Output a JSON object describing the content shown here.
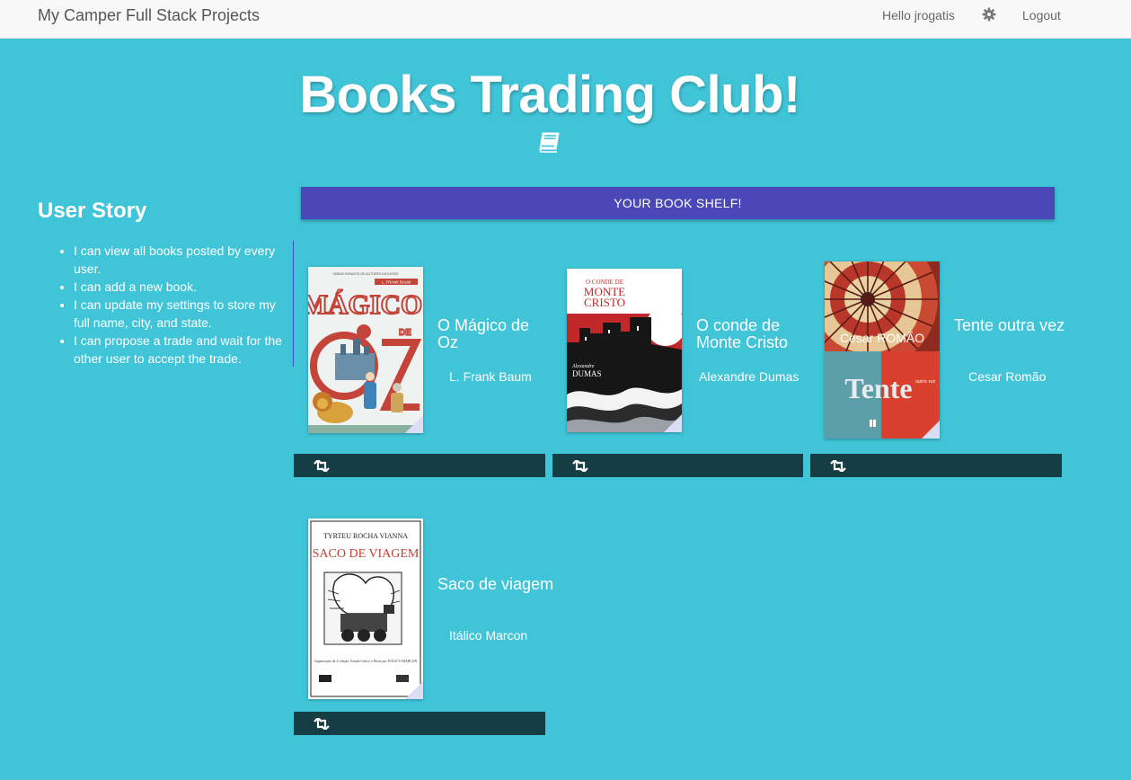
{
  "navbar": {
    "brand": "My Camper Full Stack Projects",
    "greeting": "Hello jrogatis",
    "settings_icon": "gear-icon",
    "logout_label": "Logout"
  },
  "hero": {
    "title": "Books Trading Club!",
    "icon": "book-icon"
  },
  "user_story": {
    "title": "User Story",
    "items": [
      "I can view all books posted by every user.",
      "I can add a new book.",
      "I can update my settings to store my full name, city, and state.",
      "I can propose a trade and wait for the other user to accept the trade."
    ]
  },
  "shelf_button": "YOUR BOOK SHELF!",
  "books": [
    {
      "title": "O Mágico de Oz",
      "author": "L. Frank Baum",
      "action_icon": "retweet-icon"
    },
    {
      "title": "O conde de Monte Cristo",
      "author": "Alexandre Dumas",
      "action_icon": "retweet-icon"
    },
    {
      "title": "Tente outra vez",
      "author": "Cesar Romão",
      "action_icon": "retweet-icon"
    },
    {
      "title": "Saco de viagem",
      "author": "Itálico Marcon",
      "action_icon": "retweet-icon"
    }
  ],
  "covers": {
    "oz": {
      "series": "OBRAS INFANTIS DE AUTORES INGLESES",
      "author": "L. FRANK BAUM",
      "word1": "MÁGICO",
      "word2": "DE",
      "word3": "OZ"
    },
    "monte": {
      "line1": "O CONDE DE",
      "line2": "MONTE",
      "line3": "CRISTO",
      "author_first": "Alexandre",
      "author_last": "DUMAS"
    },
    "tente": {
      "author": "Cesar ROMÃO",
      "subtitle": "Motivação para Transformação",
      "word": "Tente",
      "word_small": "outra vez"
    },
    "saco": {
      "author": "TYRTEU ROCHA VIANNA",
      "title": "SACO DE VIAGEM",
      "note": "Organização da 2ª edição, Estudo Crítico e Notas por ITÁLICO MARCON"
    }
  },
  "colors": {
    "background": "#40c4d8",
    "button": "#4a47b8",
    "trade_bar": "#143d44"
  }
}
